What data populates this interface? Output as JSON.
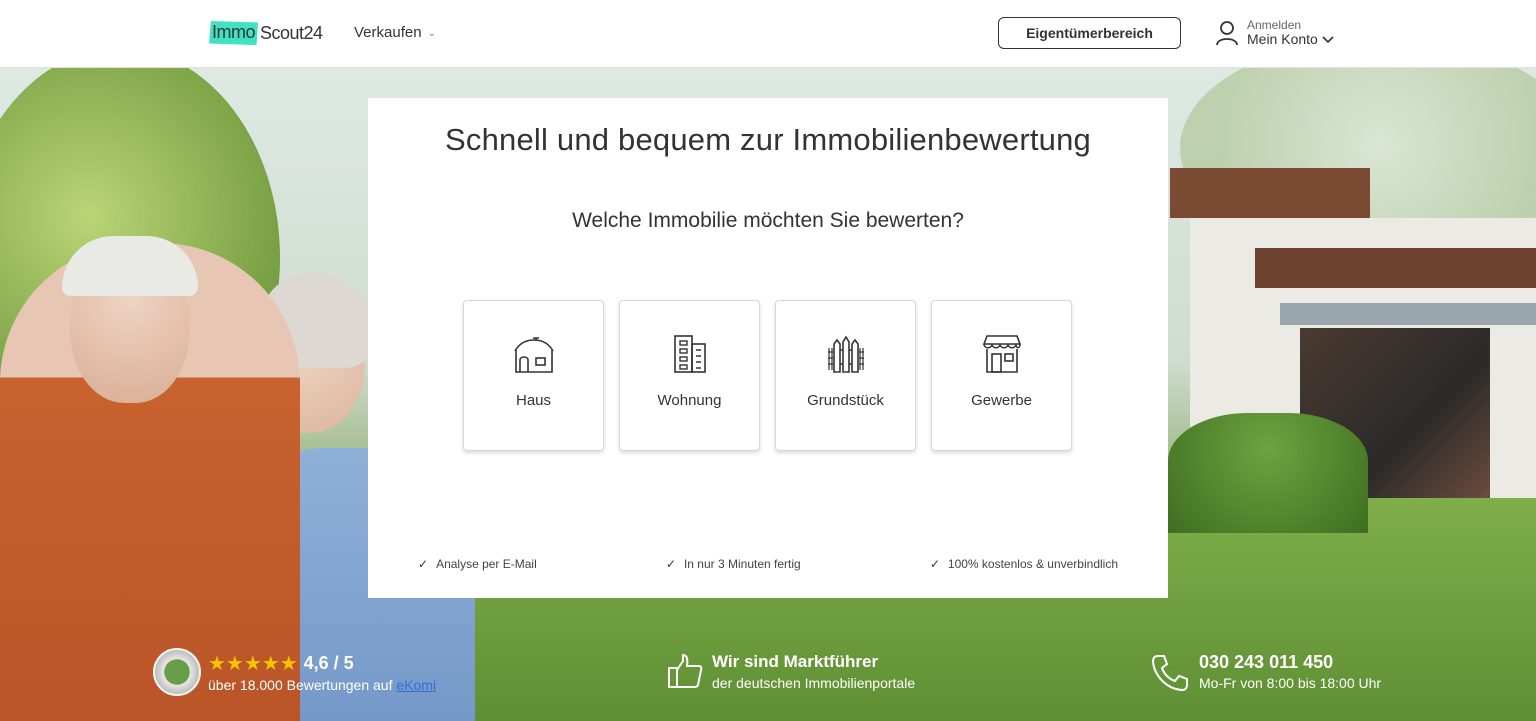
{
  "header": {
    "logo_immo": "Immo",
    "logo_scout": "Scout24",
    "nav_sell": "Verkaufen",
    "owner_button": "Eigentümerbereich",
    "account_small": "Anmelden",
    "account_main": "Mein Konto"
  },
  "card": {
    "title": "Schnell und bequem zur Immobilienbewertung",
    "subtitle": "Welche Immobilie möchten Sie bewerten?",
    "options": [
      {
        "label": "Haus",
        "icon": "house-icon"
      },
      {
        "label": "Wohnung",
        "icon": "apartment-icon"
      },
      {
        "label": "Grundstück",
        "icon": "plot-fence-icon"
      },
      {
        "label": "Gewerbe",
        "icon": "shop-icon"
      }
    ],
    "benefits": [
      "Analyse per E-Mail",
      "In nur 3 Minuten fertig",
      "100% kostenlos & unverbindlich"
    ]
  },
  "strip": {
    "stars": "★★★★★",
    "rating": "4,6 / 5",
    "reviews_prefix": "über 18.000 Bewertungen auf",
    "reviews_link": "eKomi",
    "leader_title": "Wir sind Marktführer",
    "leader_sub": "der deutschen Immobilienportale",
    "phone": "030 243 011 450",
    "hours": "Mo-Fr von 8:00 bis 18:00 Uhr"
  },
  "colors": {
    "brand_accent": "#3fe3c3",
    "star": "#f6c300",
    "link": "#2f6fd8"
  }
}
